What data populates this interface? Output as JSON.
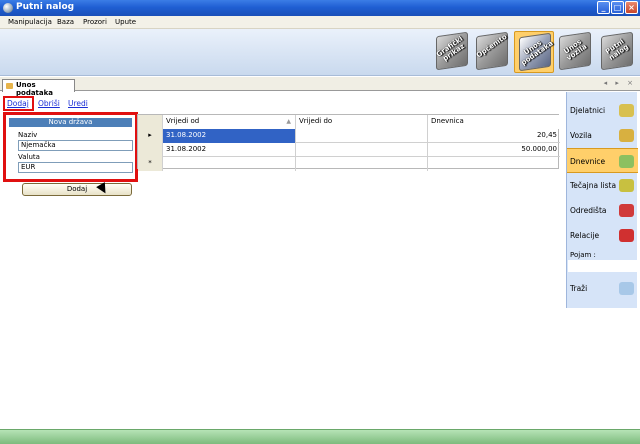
{
  "window": {
    "title": "Putni nalog",
    "min": "_",
    "max": "□",
    "close": "×"
  },
  "menu": [
    "Manipulacija",
    "Baza",
    "Prozori",
    "Upute"
  ],
  "toolbar": [
    {
      "label": "Grafički prikaz",
      "active": false
    },
    {
      "label": "Općenito",
      "active": false
    },
    {
      "label": "Unos podataka",
      "active": true
    },
    {
      "label": "Unos vozila",
      "active": false
    },
    {
      "label": "Putni nalog",
      "active": false
    }
  ],
  "doc_tab": {
    "label": "Unos podataka",
    "controls": "◂ ▸ ×"
  },
  "actions": {
    "add": "Dodaj",
    "delete": "Obriši",
    "edit": "Uredi"
  },
  "form": {
    "header": "Nova država",
    "name_label": "Naziv",
    "name_value": "Njemačka",
    "currency_label": "Valuta",
    "currency_value": "EUR",
    "submit": "Dodaj"
  },
  "grid": {
    "columns": [
      "Vrijedi od",
      "Vrijedi do",
      "Dnevnica"
    ],
    "current_marker": "▸",
    "new_marker": "*",
    "sort_glyph": "▲",
    "rows": [
      [
        "31.08.2002",
        "",
        "20,45"
      ],
      [
        "31.08.2002",
        "",
        "50.000,00"
      ]
    ]
  },
  "right_panel": {
    "items": [
      {
        "label": "Djelatnici",
        "icon": "#d8c050",
        "active": false
      },
      {
        "label": "Vozila",
        "icon": "#d8b040",
        "active": false
      },
      {
        "label": "Dnevnice",
        "icon": "#8cc060",
        "active": true
      },
      {
        "label": "Tečajna lista",
        "icon": "#c8c040",
        "active": false
      },
      {
        "label": "Odredišta",
        "icon": "#d03a3a",
        "active": false
      },
      {
        "label": "Relacije",
        "icon": "#d03030",
        "active": false
      }
    ],
    "search_label": "Pojam :",
    "search_button": "Traži"
  }
}
